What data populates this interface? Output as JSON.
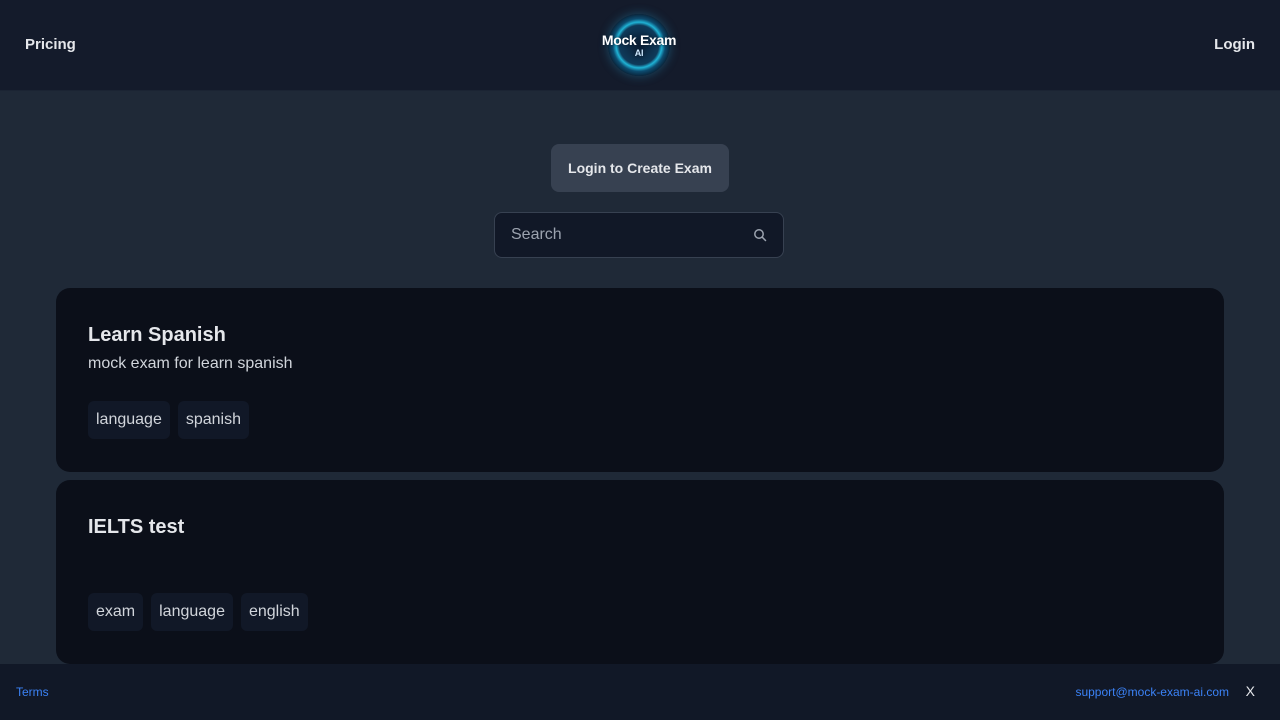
{
  "header": {
    "pricing_label": "Pricing",
    "login_label": "Login",
    "logo_title": "Mock Exam",
    "logo_sub": "AI"
  },
  "main": {
    "create_button_label": "Login to Create Exam",
    "search": {
      "placeholder": "Search",
      "value": ""
    },
    "exams": [
      {
        "title": "Learn Spanish",
        "description": "mock exam for learn spanish",
        "tags": [
          "language",
          "spanish"
        ]
      },
      {
        "title": "IELTS test",
        "description": "",
        "tags": [
          "exam",
          "language",
          "english"
        ]
      }
    ]
  },
  "footer": {
    "terms_label": "Terms",
    "support_email": "support@mock-exam-ai.com",
    "close_label": "X"
  },
  "colors": {
    "background": "#1f2937",
    "header": "#141b2b",
    "card": "#0b0f19",
    "link": "#3b82f6"
  }
}
